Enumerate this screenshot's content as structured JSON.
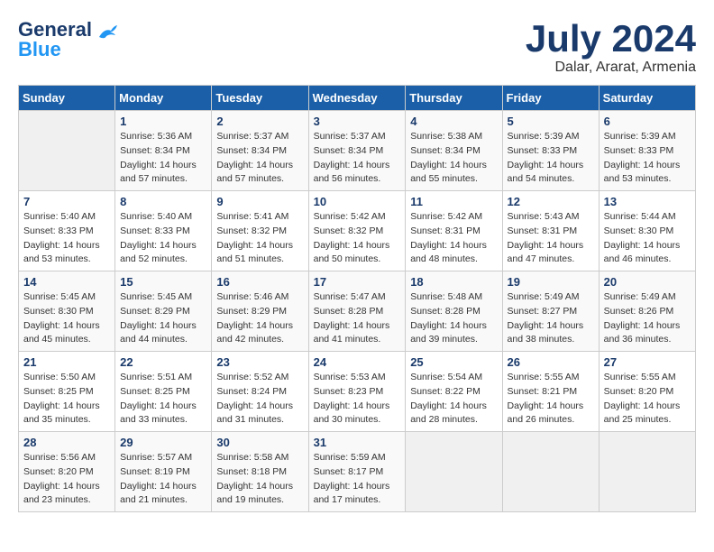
{
  "header": {
    "logo_line1": "General",
    "logo_line2": "Blue",
    "month": "July 2024",
    "location": "Dalar, Ararat, Armenia"
  },
  "weekdays": [
    "Sunday",
    "Monday",
    "Tuesday",
    "Wednesday",
    "Thursday",
    "Friday",
    "Saturday"
  ],
  "weeks": [
    [
      {
        "day": "",
        "info": ""
      },
      {
        "day": "1",
        "info": "Sunrise: 5:36 AM\nSunset: 8:34 PM\nDaylight: 14 hours\nand 57 minutes."
      },
      {
        "day": "2",
        "info": "Sunrise: 5:37 AM\nSunset: 8:34 PM\nDaylight: 14 hours\nand 57 minutes."
      },
      {
        "day": "3",
        "info": "Sunrise: 5:37 AM\nSunset: 8:34 PM\nDaylight: 14 hours\nand 56 minutes."
      },
      {
        "day": "4",
        "info": "Sunrise: 5:38 AM\nSunset: 8:34 PM\nDaylight: 14 hours\nand 55 minutes."
      },
      {
        "day": "5",
        "info": "Sunrise: 5:39 AM\nSunset: 8:33 PM\nDaylight: 14 hours\nand 54 minutes."
      },
      {
        "day": "6",
        "info": "Sunrise: 5:39 AM\nSunset: 8:33 PM\nDaylight: 14 hours\nand 53 minutes."
      }
    ],
    [
      {
        "day": "7",
        "info": "Sunrise: 5:40 AM\nSunset: 8:33 PM\nDaylight: 14 hours\nand 53 minutes."
      },
      {
        "day": "8",
        "info": "Sunrise: 5:40 AM\nSunset: 8:33 PM\nDaylight: 14 hours\nand 52 minutes."
      },
      {
        "day": "9",
        "info": "Sunrise: 5:41 AM\nSunset: 8:32 PM\nDaylight: 14 hours\nand 51 minutes."
      },
      {
        "day": "10",
        "info": "Sunrise: 5:42 AM\nSunset: 8:32 PM\nDaylight: 14 hours\nand 50 minutes."
      },
      {
        "day": "11",
        "info": "Sunrise: 5:42 AM\nSunset: 8:31 PM\nDaylight: 14 hours\nand 48 minutes."
      },
      {
        "day": "12",
        "info": "Sunrise: 5:43 AM\nSunset: 8:31 PM\nDaylight: 14 hours\nand 47 minutes."
      },
      {
        "day": "13",
        "info": "Sunrise: 5:44 AM\nSunset: 8:30 PM\nDaylight: 14 hours\nand 46 minutes."
      }
    ],
    [
      {
        "day": "14",
        "info": "Sunrise: 5:45 AM\nSunset: 8:30 PM\nDaylight: 14 hours\nand 45 minutes."
      },
      {
        "day": "15",
        "info": "Sunrise: 5:45 AM\nSunset: 8:29 PM\nDaylight: 14 hours\nand 44 minutes."
      },
      {
        "day": "16",
        "info": "Sunrise: 5:46 AM\nSunset: 8:29 PM\nDaylight: 14 hours\nand 42 minutes."
      },
      {
        "day": "17",
        "info": "Sunrise: 5:47 AM\nSunset: 8:28 PM\nDaylight: 14 hours\nand 41 minutes."
      },
      {
        "day": "18",
        "info": "Sunrise: 5:48 AM\nSunset: 8:28 PM\nDaylight: 14 hours\nand 39 minutes."
      },
      {
        "day": "19",
        "info": "Sunrise: 5:49 AM\nSunset: 8:27 PM\nDaylight: 14 hours\nand 38 minutes."
      },
      {
        "day": "20",
        "info": "Sunrise: 5:49 AM\nSunset: 8:26 PM\nDaylight: 14 hours\nand 36 minutes."
      }
    ],
    [
      {
        "day": "21",
        "info": "Sunrise: 5:50 AM\nSunset: 8:25 PM\nDaylight: 14 hours\nand 35 minutes."
      },
      {
        "day": "22",
        "info": "Sunrise: 5:51 AM\nSunset: 8:25 PM\nDaylight: 14 hours\nand 33 minutes."
      },
      {
        "day": "23",
        "info": "Sunrise: 5:52 AM\nSunset: 8:24 PM\nDaylight: 14 hours\nand 31 minutes."
      },
      {
        "day": "24",
        "info": "Sunrise: 5:53 AM\nSunset: 8:23 PM\nDaylight: 14 hours\nand 30 minutes."
      },
      {
        "day": "25",
        "info": "Sunrise: 5:54 AM\nSunset: 8:22 PM\nDaylight: 14 hours\nand 28 minutes."
      },
      {
        "day": "26",
        "info": "Sunrise: 5:55 AM\nSunset: 8:21 PM\nDaylight: 14 hours\nand 26 minutes."
      },
      {
        "day": "27",
        "info": "Sunrise: 5:55 AM\nSunset: 8:20 PM\nDaylight: 14 hours\nand 25 minutes."
      }
    ],
    [
      {
        "day": "28",
        "info": "Sunrise: 5:56 AM\nSunset: 8:20 PM\nDaylight: 14 hours\nand 23 minutes."
      },
      {
        "day": "29",
        "info": "Sunrise: 5:57 AM\nSunset: 8:19 PM\nDaylight: 14 hours\nand 21 minutes."
      },
      {
        "day": "30",
        "info": "Sunrise: 5:58 AM\nSunset: 8:18 PM\nDaylight: 14 hours\nand 19 minutes."
      },
      {
        "day": "31",
        "info": "Sunrise: 5:59 AM\nSunset: 8:17 PM\nDaylight: 14 hours\nand 17 minutes."
      },
      {
        "day": "",
        "info": ""
      },
      {
        "day": "",
        "info": ""
      },
      {
        "day": "",
        "info": ""
      }
    ]
  ]
}
